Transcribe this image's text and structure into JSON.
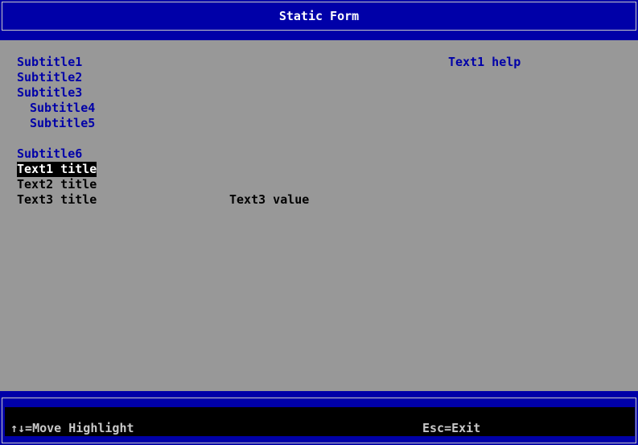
{
  "window": {
    "title": "Static Form"
  },
  "form": {
    "subtitles": [
      "Subtitle1",
      "Subtitle2",
      "Subtitle3",
      "Subtitle4",
      "Subtitle5",
      "Subtitle6"
    ],
    "fields": [
      {
        "title": "Text1 title",
        "value": "",
        "selected": true
      },
      {
        "title": "Text2 title",
        "value": ""
      },
      {
        "title": "Text3 title",
        "value": "Text3 value"
      }
    ],
    "help_text": "Text1 help"
  },
  "footer": {
    "move_hint": "↑↓=Move Highlight",
    "exit_hint": "Esc=Exit"
  },
  "colors": {
    "header_background": "#0000a8",
    "form_background": "#989898",
    "subtitle_text": "#0000a8",
    "field_text": "#000000",
    "highlight_background": "#000000",
    "highlight_text": "#ffffff",
    "footer_text": "#c8c8c8"
  }
}
